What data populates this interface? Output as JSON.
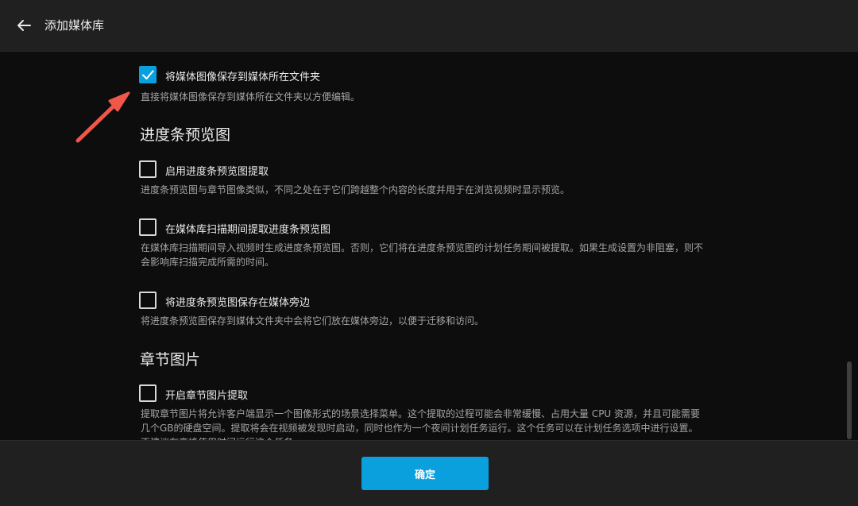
{
  "header": {
    "title": "添加媒体库",
    "back_icon": "arrow-left-icon"
  },
  "options": {
    "save_images": {
      "checked": true,
      "label": "将媒体图像保存到媒体所在文件夹",
      "desc": "直接将媒体图像保存到媒体所在文件夹以方便编辑。"
    },
    "trickplay": {
      "title": "进度条预览图",
      "items": [
        {
          "checked": false,
          "label": "启用进度条预览图提取",
          "desc": "进度条预览图与章节图像类似，不同之处在于它们跨越整个内容的长度并用于在浏览视频时显示预览。"
        },
        {
          "checked": false,
          "label": "在媒体库扫描期间提取进度条预览图",
          "desc": "在媒体库扫描期间导入视频时生成进度条预览图。否则，它们将在进度条预览图的计划任务期间被提取。如果生成设置为非阻塞，则不会影响库扫描完成所需的时间。"
        },
        {
          "checked": false,
          "label": "将进度条预览图保存在媒体旁边",
          "desc": "将进度条预览图保存到媒体文件夹中会将它们放在媒体旁边，以便于迁移和访问。"
        }
      ]
    },
    "chapters": {
      "title": "章节图片",
      "items": [
        {
          "checked": false,
          "label": "开启章节图片提取",
          "desc": "提取章节图片将允许客户端显示一个图像形式的场景选择菜单。这个提取的过程可能会非常缓慢、占用大量 CPU 资源，并且可能需要几个GB的硬盘空间。提取将会在视频被发现时启动，同时也作为一个夜间计划任务运行。这个任务可以在计划任务选项中进行设置。不建议在高峰使用时间运行这个任务。"
        }
      ]
    }
  },
  "footer": {
    "confirm_label": "确定"
  },
  "colors": {
    "accent": "#0aa0de",
    "annotation_arrow": "#f0564a"
  }
}
